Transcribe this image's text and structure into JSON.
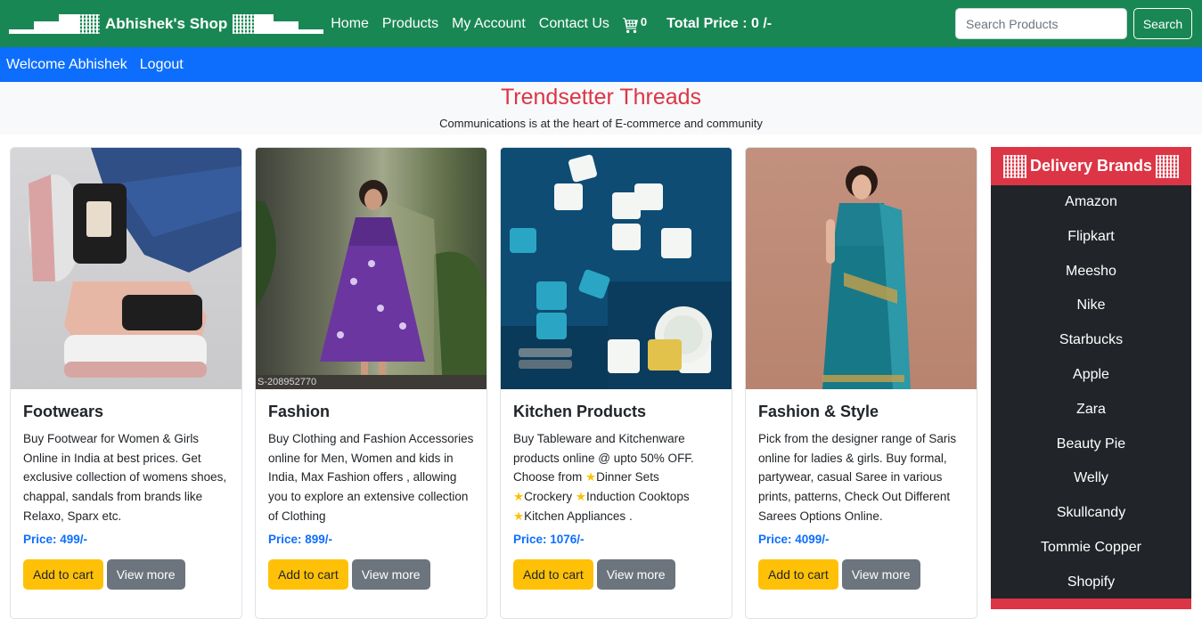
{
  "nav": {
    "brand": "Abhishek's Shop",
    "links": [
      "Home",
      "Products",
      "My Account",
      "Contact Us"
    ],
    "cart_count": "0",
    "total_price": "Total Price : 0 /-",
    "search_placeholder": "Search Products",
    "search_button": "Search"
  },
  "userbar": {
    "welcome": "Welcome Abhishek",
    "logout": "Logout"
  },
  "hero": {
    "title": "Trendsetter Threads",
    "subtitle": "Communications is at the heart of E-commerce and community"
  },
  "products": [
    {
      "title": "Footwears",
      "description": "Buy Footwear for Women & Girls Online in India at best prices. Get exclusive collection of womens shoes, chappal, sandals from brands like Relaxo, Sparx etc.",
      "price": "Price: 499/-",
      "add_label": "Add to cart",
      "view_label": "View more"
    },
    {
      "title": "Fashion",
      "description": "Buy Clothing and Fashion Accessories online for Men, Women and kids in India, Max Fashion offers , allowing you to explore an extensive collection of Clothing",
      "price": "Price: 899/-",
      "add_label": "Add to cart",
      "view_label": "View more",
      "watermark": "S-208952770"
    },
    {
      "title": "Kitchen Products",
      "description_parts": [
        "Buy Tableware and Kitchenware products online @ upto 50% OFF. Choose from ",
        "Dinner Sets",
        "Crockery",
        "Induction Cooktops",
        "Kitchen Appliances ."
      ],
      "price": "Price: 1076/-",
      "add_label": "Add to cart",
      "view_label": "View more"
    },
    {
      "title": "Fashion & Style",
      "description": "Pick from the designer range of Saris online for ladies & girls. Buy formal, partywear, casual Saree in various prints, patterns, Check Out Different Sarees Options Online.",
      "price": "Price: 4099/-",
      "add_label": "Add to cart",
      "view_label": "View more"
    }
  ],
  "sidebar": {
    "title": "Delivery Brands",
    "brands": [
      "Amazon",
      "Flipkart",
      "Meesho",
      "Nike",
      "Starbucks",
      "Apple",
      "Zara",
      "Beauty Pie",
      "Welly",
      "Skullcandy",
      "Tommie Copper",
      "Shopify"
    ]
  },
  "colors": {
    "navbar": "#198754",
    "userbar": "#0d6efd",
    "hero_title": "#dc3545",
    "price": "#0d6efd",
    "add_button": "#ffc107",
    "view_button": "#6c757d",
    "sidebar_bg": "#212529",
    "sidebar_head": "#dc3545"
  }
}
